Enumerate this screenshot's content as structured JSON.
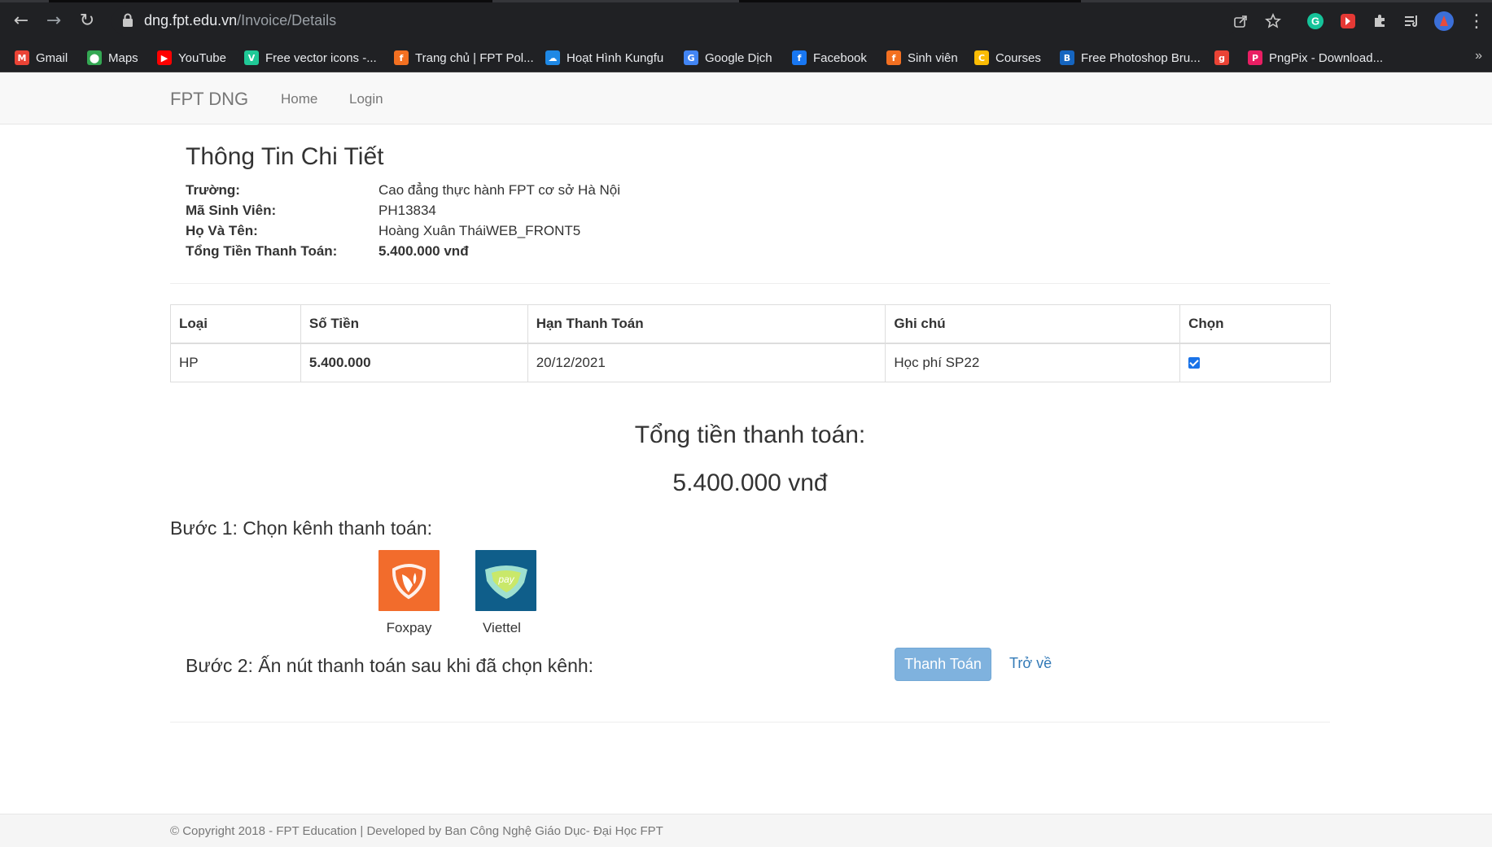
{
  "browser": {
    "url_host": "dng.fpt.edu.vn",
    "url_path": "/Invoice/Details",
    "back_glyph": "←",
    "forward_glyph": "→",
    "reload_glyph": "↻",
    "menu_glyph": "⋮"
  },
  "bookmarks": [
    {
      "label": "Gmail",
      "icon": "gmail-icon",
      "color": "#ea4335",
      "glyph": "M"
    },
    {
      "label": "Maps",
      "icon": "maps-icon",
      "color": "#34a853",
      "glyph": "⬤"
    },
    {
      "label": "YouTube",
      "icon": "youtube-icon",
      "color": "#ff0000",
      "glyph": "▶"
    },
    {
      "label": "Free vector icons -...",
      "icon": "vector-icon",
      "color": "#20c997",
      "glyph": "V"
    },
    {
      "label": "Trang chủ | FPT Pol...",
      "icon": "fpt-icon",
      "color": "#f37021",
      "glyph": "f"
    },
    {
      "label": "Hoạt Hình Kungfu",
      "icon": "cloud-icon",
      "color": "#1e88e5",
      "glyph": "☁"
    },
    {
      "label": "Google Dịch",
      "icon": "translate-icon",
      "color": "#4285f4",
      "glyph": "G"
    },
    {
      "label": "Facebook",
      "icon": "facebook-icon",
      "color": "#1877f2",
      "glyph": "f"
    },
    {
      "label": "Sinh viên",
      "icon": "fpt-icon",
      "color": "#f37021",
      "glyph": "f"
    },
    {
      "label": "Courses",
      "icon": "classroom-icon",
      "color": "#fbbc04",
      "glyph": "C"
    },
    {
      "label": "Free Photoshop Bru...",
      "icon": "brush-icon",
      "color": "#1565c0",
      "glyph": "B"
    },
    {
      "label": "",
      "icon": "google-plus-icon",
      "color": "#ea4335",
      "glyph": "g"
    },
    {
      "label": "PngPix - Download...",
      "icon": "pngpix-icon",
      "color": "#e91e63",
      "glyph": "P"
    }
  ],
  "bookmarks_more": "»",
  "site": {
    "brand": "FPT DNG",
    "nav": [
      "Home",
      "Login"
    ]
  },
  "details": {
    "title": "Thông Tin Chi Tiết",
    "rows": [
      {
        "label": "Trường:",
        "value": "Cao đẳng thực hành FPT cơ sở Hà Nội",
        "bold": false
      },
      {
        "label": "Mã Sinh Viên:",
        "value": "PH13834",
        "bold": false
      },
      {
        "label": "Họ Và Tên:",
        "value": "Hoàng Xuân TháiWEB_FRONT5",
        "bold": false
      },
      {
        "label": "Tổng Tiền Thanh Toán:",
        "value": "5.400.000 vnđ",
        "bold": true
      }
    ]
  },
  "table": {
    "headers": [
      "Loại",
      "Số Tiền",
      "Hạn Thanh Toán",
      "Ghi chú",
      "Chọn"
    ],
    "rows": [
      {
        "type": "HP",
        "amount": "5.400.000",
        "due": "20/12/2021",
        "note": "Học phí SP22",
        "checked": true
      }
    ]
  },
  "summary": {
    "label": "Tổng tiền thanh toán:",
    "value": "5.400.000 vnđ"
  },
  "step1": {
    "label": "Bước 1: Chọn kênh thanh toán:",
    "channels": [
      {
        "name": "Foxpay",
        "color": "#f26c2c"
      },
      {
        "name": "Viettel",
        "color": "#0f5e8a"
      }
    ]
  },
  "step2": {
    "label": "Bước 2: Ấn nút thanh toán sau khi đã chọn kênh:",
    "pay_button": "Thanh Toán",
    "back_link": "Trở về"
  },
  "footer": {
    "text": "© Copyright 2018 - FPT Education | Developed by Ban Công Nghệ Giáo Dục- Đại Học FPT"
  }
}
